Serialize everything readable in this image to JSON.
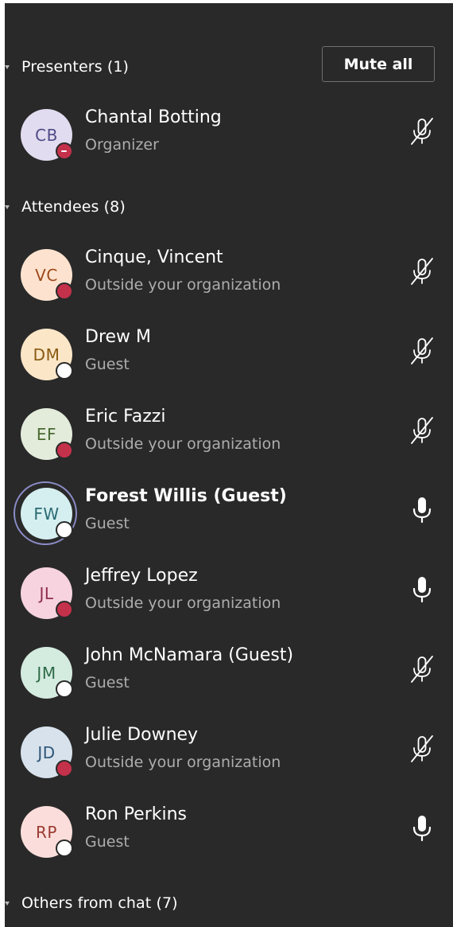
{
  "sections": {
    "presenters": {
      "title": "Presenters (1)",
      "mute_all_label": "Mute all"
    },
    "attendees": {
      "title": "Attendees (8)"
    },
    "others": {
      "title": "Others from chat (7)"
    }
  },
  "participants": [
    {
      "initials": "CB",
      "name": "Chantal Botting",
      "subtitle": "Organizer",
      "status": "dnd",
      "mic": "mic-off-icon",
      "avatar_bg": "#e1dcef",
      "avatar_fg": "#4f4a86"
    },
    {
      "initials": "VC",
      "name": "Cinque, Vincent",
      "subtitle": "Outside your organization",
      "status": "busy",
      "mic": "mic-off-icon",
      "avatar_bg": "#fde3cf",
      "avatar_fg": "#9c4a1a"
    },
    {
      "initials": "DM",
      "name": "Drew M",
      "subtitle": "Guest",
      "status": "offline",
      "mic": "mic-off-icon",
      "avatar_bg": "#fbe6c8",
      "avatar_fg": "#8a5a12"
    },
    {
      "initials": "EF",
      "name": "Eric Fazzi",
      "subtitle": "Outside your organization",
      "status": "busy",
      "mic": "mic-off-icon",
      "avatar_bg": "#e3ecdb",
      "avatar_fg": "#4a6a32"
    },
    {
      "initials": "FW",
      "name": "Forest Willis (Guest)",
      "subtitle": "Guest",
      "status": "offline",
      "mic": "mic-on-icon",
      "avatar_bg": "#d5eff0",
      "avatar_fg": "#2a6a73",
      "speaking": true
    },
    {
      "initials": "JL",
      "name": "Jeffrey Lopez",
      "subtitle": "Outside your organization",
      "status": "busy",
      "mic": "mic-on-icon",
      "avatar_bg": "#f6d3de",
      "avatar_fg": "#8e2e4e"
    },
    {
      "initials": "JM",
      "name": "John McNamara (Guest)",
      "subtitle": "Guest",
      "status": "offline",
      "mic": "mic-off-icon",
      "avatar_bg": "#d4ebdf",
      "avatar_fg": "#2c6a47"
    },
    {
      "initials": "JD",
      "name": "Julie Downey",
      "subtitle": "Outside your organization",
      "status": "busy",
      "mic": "mic-off-icon",
      "avatar_bg": "#d7e2ec",
      "avatar_fg": "#2f5678"
    },
    {
      "initials": "RP",
      "name": "Ron Perkins",
      "subtitle": "Guest",
      "status": "offline",
      "mic": "mic-on-icon",
      "avatar_bg": "#fbdedb",
      "avatar_fg": "#9a3b32"
    }
  ]
}
